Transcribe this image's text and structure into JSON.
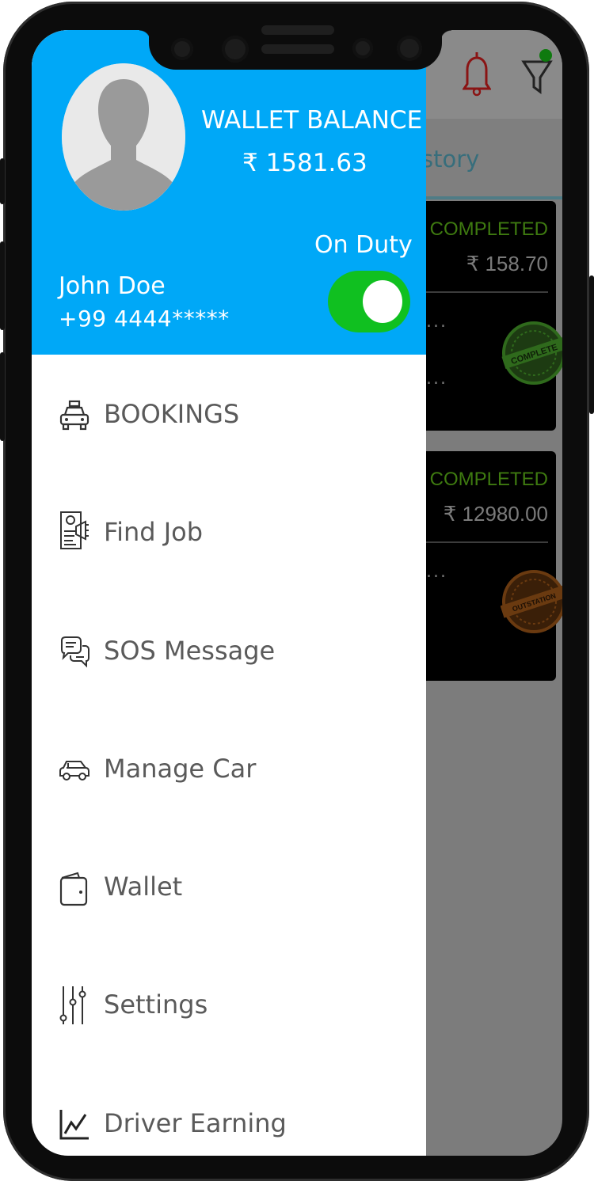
{
  "drawer": {
    "wallet_title": "WALLET BALANCE",
    "wallet_amount": "₹ 1581.63",
    "duty_label": "On Duty",
    "duty_on": true,
    "user_name": "John Doe",
    "user_phone": "+99 4444*****",
    "menu": [
      {
        "label": "BOOKINGS",
        "icon": "taxi-icon"
      },
      {
        "label": "Find Job",
        "icon": "job-document-icon"
      },
      {
        "label": "SOS Message",
        "icon": "chat-bubbles-icon"
      },
      {
        "label": "Manage Car",
        "icon": "car-icon"
      },
      {
        "label": "Wallet",
        "icon": "wallet-icon"
      },
      {
        "label": "Settings",
        "icon": "sliders-icon"
      },
      {
        "label": "Driver Earning",
        "icon": "line-chart-icon"
      }
    ]
  },
  "background": {
    "tab_fragment": "story",
    "cards": [
      {
        "status": "COMPLETED",
        "price": "₹ 158.70",
        "stamp": "COMPLETE",
        "dots": "..."
      },
      {
        "status": "COMPLETED",
        "price": "₹ 12980.00",
        "stamp": "OUTSTATION",
        "dots": "..."
      }
    ]
  },
  "colors": {
    "header_blue": "#00a8f7",
    "toggle_green": "#10c020",
    "status_green": "#3e7a10"
  }
}
